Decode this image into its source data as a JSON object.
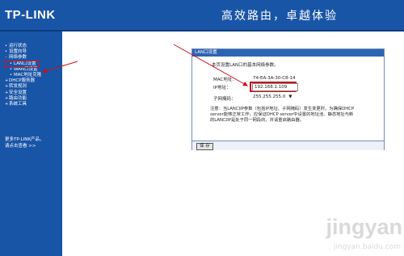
{
  "header": {
    "logo": "TP-LINK",
    "slogan": "高效路由，卓越体验"
  },
  "sidebar": {
    "items": [
      {
        "label": "运行状态",
        "sub": false
      },
      {
        "label": "设置向导",
        "sub": false
      },
      {
        "label": "网络参数",
        "sub": false
      },
      {
        "label": "LAN口设置",
        "sub": true,
        "active": true
      },
      {
        "label": "WAN口设置",
        "sub": true
      },
      {
        "label": "MAC地址克隆",
        "sub": true
      },
      {
        "label": "DHCP服务器",
        "sub": false
      },
      {
        "label": "转发规则",
        "sub": false
      },
      {
        "label": "安全设置",
        "sub": false
      },
      {
        "label": "路由功能",
        "sub": false
      },
      {
        "label": "系统工具",
        "sub": false
      }
    ],
    "more_line1": "更多TP-LINK产品，",
    "more_line2": "请点击查看 >>"
  },
  "panel": {
    "title": "LAN口设置",
    "intro": "本页设置LAN口的基本网络参数。",
    "mac_label": "MAC地址：",
    "mac_value": "74-EA-3A-30-C8-14",
    "ip_label": "IP地址：",
    "ip_value": "192.168.1.109",
    "mask_label": "子网掩码：",
    "mask_value": "255.255.255.0",
    "mask_arrow": "▼",
    "note_line1": "注意：当LAN口IP参数（包括IP地址、子网掩码）发生变更时，为确保DHCP",
    "note_line2": "server能够正常工作，应保证DHCP server中设置的地址池、静态地址与新",
    "note_line3": "的LAN口IP是处于同一网段的，并请重启路由器。",
    "save_label": "保 存"
  },
  "watermark": {
    "main": "jingyan",
    "sub": "jingyan.baidu.com"
  },
  "colors": {
    "brand_blue": "#1955a7",
    "highlight_red": "#c8121a"
  }
}
